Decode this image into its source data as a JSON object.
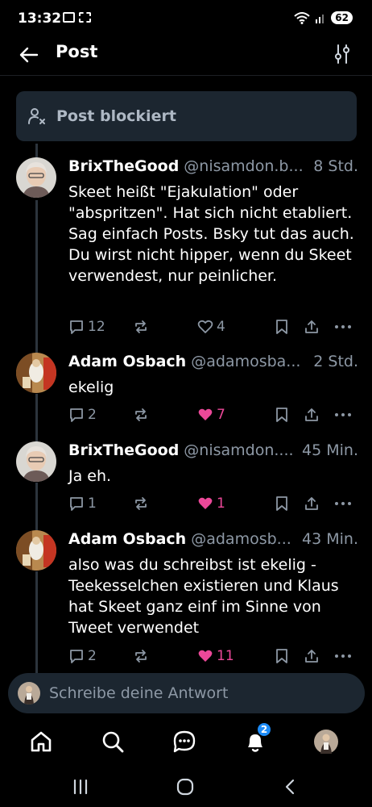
{
  "status_bar": {
    "time": "13:32",
    "battery": "62"
  },
  "header": {
    "title": "Post"
  },
  "blocked_notice": {
    "label": "Post blockiert"
  },
  "posts": [
    {
      "author": "BrixTheGood",
      "handle": "@nisamdon.b...",
      "time": "8 Std.",
      "text": "Skeet heißt \"Ejakulation\" oder \"abspritzen\". Hat sich nicht etabliert. Sag einfach Posts. Bsky tut das auch. Du wirst nicht hipper, wenn du Skeet verwendest, nur peinlicher.",
      "replies": "12",
      "likes": "4",
      "liked": false
    },
    {
      "author": "Adam Osbach",
      "handle": "@adamosba...",
      "time": "2 Std.",
      "text": "ekelig",
      "replies": "2",
      "likes": "7",
      "liked": true
    },
    {
      "author": "BrixTheGood",
      "handle": "@nisamdon....",
      "time": "45 Min.",
      "text": "Ja eh.",
      "replies": "1",
      "likes": "1",
      "liked": true
    },
    {
      "author": "Adam Osbach",
      "handle": "@adamosb...",
      "time": "43 Min.",
      "text": "also was du schreibst ist ekelig - Teekesselchen existieren und Klaus hat Skeet ganz einf im Sinne von Tweet verwendet",
      "replies": "2",
      "likes": "11",
      "liked": true
    }
  ],
  "composer": {
    "placeholder": "Schreibe deine Antwort"
  },
  "bottom_nav": {
    "notifications_badge": "2"
  },
  "colors": {
    "background": "#000000",
    "card": "#1c2630",
    "muted": "#8d98a5",
    "like": "#ec4899",
    "accent": "#1d8cf8"
  }
}
